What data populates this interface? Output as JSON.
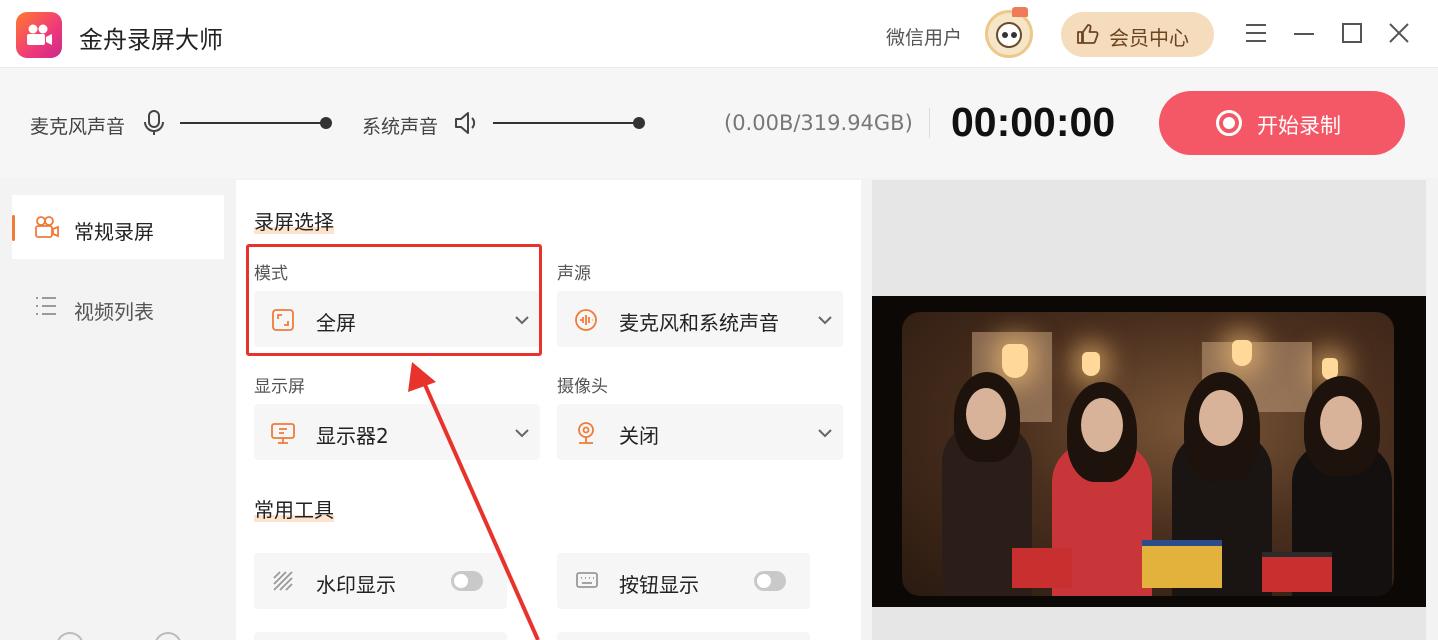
{
  "titlebar": {
    "app_title": "金舟录屏大师",
    "user_name": "微信用户",
    "vip_label": "会员中心",
    "controls": [
      "menu-icon",
      "minimize-icon",
      "maximize-icon",
      "close-icon"
    ]
  },
  "recbar": {
    "mic_label": "麦克风声音",
    "mic_icon": "microphone-icon",
    "system_label": "系统声音",
    "system_icon": "speaker-icon",
    "storage": "(0.00B/319.94GB)",
    "timer": "00:00:00",
    "start_label": "开始录制"
  },
  "sidebar": {
    "items": [
      {
        "label": "常规录屏",
        "icon": "record-camera-icon",
        "active": true
      },
      {
        "label": "视频列表",
        "icon": "list-icon",
        "active": false
      }
    ]
  },
  "panel": {
    "section_record": "录屏选择",
    "mode": {
      "label": "模式",
      "value": "全屏",
      "icon": "fullscreen-icon"
    },
    "audio_source": {
      "label": "声源",
      "value": "麦克风和系统声音",
      "icon": "audio-source-icon"
    },
    "display": {
      "label": "显示屏",
      "value": "显示器2",
      "icon": "monitor-icon"
    },
    "camera": {
      "label": "摄像头",
      "value": "关闭",
      "icon": "webcam-icon"
    },
    "section_tools": "常用工具",
    "tools": [
      {
        "label": "水印显示",
        "icon": "watermark-icon",
        "enabled": false
      },
      {
        "label": "按钮显示",
        "icon": "keyboard-icon",
        "enabled": false
      }
    ]
  },
  "colors": {
    "accent": "#f07b3a",
    "record_button": "#f45866",
    "annotation": "#e8332c",
    "vip_bg": "#f5dcbc"
  }
}
